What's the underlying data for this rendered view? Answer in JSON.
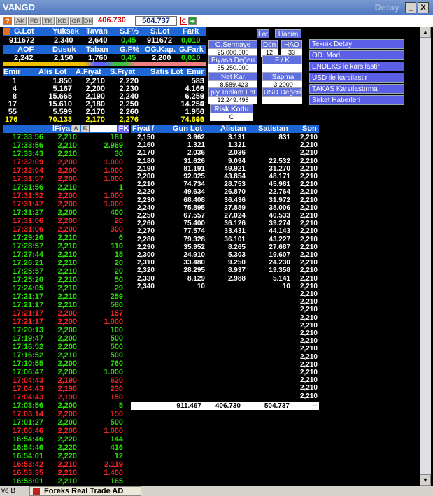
{
  "window": {
    "title": "VANGD",
    "detail": "Detay",
    "min": "_",
    "max": "□",
    "close": "X"
  },
  "toolbar": {
    "tabs": [
      "?",
      "AK",
      "FD",
      "TK",
      "KD",
      "GR",
      "DK"
    ],
    "value_red": "406.730",
    "value_blue": "504.737",
    "c_label": "C",
    "arrow": "➔"
  },
  "summary": {
    "r1_headers": [
      "G.Lot",
      "Yuksek",
      "Tavan",
      "S.F%",
      "S.Lot",
      "Fark"
    ],
    "r1_values": [
      "911672",
      "2,340",
      "2,640",
      "0,45",
      "911672",
      "0,010"
    ],
    "r2_headers": [
      "AOF",
      "Dusuk",
      "Taban",
      "G.F%",
      "OG.Kap.",
      "G.Fark"
    ],
    "r2_values": [
      "2,242",
      "2,150",
      "1,760",
      "0,45",
      "2,200",
      "0,010"
    ]
  },
  "depth": {
    "headers": [
      "Emir",
      "Alis Lot",
      "A.Fiyat",
      "S.Fiyat",
      "Satis Lot",
      "Emir"
    ],
    "rows": [
      [
        "1",
        "1.850",
        "2,210",
        "2,220",
        "585",
        "3"
      ],
      [
        "4",
        "5.167",
        "2,200",
        "2,230",
        "4.169",
        "6"
      ],
      [
        "8",
        "15.665",
        "2,190",
        "2,240",
        "6.259",
        "8"
      ],
      [
        "17",
        "15.610",
        "2,180",
        "2,250",
        "14.254",
        "9"
      ],
      [
        "55",
        "5.599",
        "2,170",
        "2,260",
        "1.950",
        "6"
      ]
    ],
    "totals": [
      "176",
      "70.133",
      "2,170",
      "2,276",
      "74.643",
      "90"
    ]
  },
  "stats": {
    "o_sermaye_label": "O.Sermaye",
    "o_sermaye": "25.000.000",
    "don_label": "Dön",
    "don": "12",
    "hao_label": "HAO",
    "hao": "33",
    "lot_label": "Lot",
    "hacim_label": "Hacim",
    "piyasa_label": "Piyasa Değeri",
    "piyasa": "55.250.000",
    "fk_label": "F / K",
    "fk": "",
    "net_kar_label": "Net Kar",
    "net_kar": "-8.589.423",
    "sapma_label": "'Sapma",
    "sapma": "-3.2000",
    "ply_label": "ply.Toplam Lot",
    "ply": "12.249.498",
    "usd_label": "USD Değeri",
    "usd": "",
    "risk_label": "Risk Kodu",
    "risk": "C"
  },
  "menu": [
    "Teknik Detay",
    "OD. Mod.",
    "ENDEKS le karsilastir",
    "USD ile karsilastir",
    "TAKAS Karsılastırma",
    "Sirket Haberleri"
  ],
  "trades": {
    "headers": {
      "fiyat": "lFiyat",
      "a": "A",
      "k": "K",
      "fk": "FK"
    },
    "rows": [
      [
        "17:33:56",
        "2,210",
        "181",
        "g"
      ],
      [
        "17:33:56",
        "2,210",
        "2.969",
        "g"
      ],
      [
        "17:33:43",
        "2,210",
        "30",
        "g"
      ],
      [
        "17:32:09",
        "2,200",
        "1.000",
        "r"
      ],
      [
        "17:32:04",
        "2,200",
        "1.000",
        "r"
      ],
      [
        "17:31:57",
        "2,200",
        "1.000",
        "r"
      ],
      [
        "17:31:56",
        "2,210",
        "1",
        "g"
      ],
      [
        "17:31:52",
        "2,200",
        "1.000",
        "r"
      ],
      [
        "17:31:47",
        "2,200",
        "1.000",
        "r"
      ],
      [
        "17:31:27",
        "2,200",
        "400",
        "g"
      ],
      [
        "17:31:06",
        "2,200",
        "20",
        "r"
      ],
      [
        "17:31:06",
        "2,200",
        "300",
        "r"
      ],
      [
        "17:29:26",
        "2,210",
        "6",
        "g"
      ],
      [
        "17:28:57",
        "2,210",
        "110",
        "g"
      ],
      [
        "17:27:44",
        "2,210",
        "15",
        "g"
      ],
      [
        "17:26:21",
        "2,210",
        "20",
        "g"
      ],
      [
        "17:25:57",
        "2,210",
        "20",
        "g"
      ],
      [
        "17:25:20",
        "2,210",
        "50",
        "g"
      ],
      [
        "17:24:05",
        "2,210",
        "29",
        "g"
      ],
      [
        "17:21:17",
        "2,210",
        "259",
        "g"
      ],
      [
        "17:21:17",
        "2,210",
        "580",
        "g"
      ],
      [
        "17:21:17",
        "2,200",
        "157",
        "r"
      ],
      [
        "17:21:17",
        "2,200",
        "1.000",
        "r"
      ],
      [
        "17:20:13",
        "2,200",
        "100",
        "g"
      ],
      [
        "17:19:47",
        "2,200",
        "500",
        "g"
      ],
      [
        "17:16:52",
        "2,200",
        "500",
        "g"
      ],
      [
        "17:16:52",
        "2,210",
        "500",
        "g"
      ],
      [
        "17:10:55",
        "2,200",
        "760",
        "g"
      ],
      [
        "17:06:47",
        "2,200",
        "1.000",
        "g"
      ],
      [
        "17:04:43",
        "2,190",
        "620",
        "r"
      ],
      [
        "17:04:43",
        "2,190",
        "230",
        "r"
      ],
      [
        "17:04:43",
        "2,190",
        "150",
        "r"
      ],
      [
        "17:03:56",
        "2,200",
        "5",
        "g"
      ],
      [
        "17:03:14",
        "2,200",
        "150",
        "r"
      ],
      [
        "17:01:27",
        "2,200",
        "500",
        "g"
      ],
      [
        "17:00:46",
        "2,200",
        "1.000",
        "r"
      ],
      [
        "16:54:46",
        "2,220",
        "144",
        "g"
      ],
      [
        "16:54:46",
        "2,220",
        "416",
        "g"
      ],
      [
        "16:54:01",
        "2,220",
        "12",
        "g"
      ],
      [
        "16:53:42",
        "2,210",
        "2.119",
        "r"
      ],
      [
        "16:53:35",
        "2,210",
        "1.400",
        "r"
      ],
      [
        "16:53:01",
        "2,210",
        "165",
        "g"
      ]
    ]
  },
  "dist": {
    "headers": [
      "Fiyat",
      "Gun Lot",
      "Alistan",
      "Satistan",
      "Son"
    ],
    "sort_mark": "/",
    "rows": [
      [
        "2,150",
        "3.962",
        "3.131",
        "831",
        "2,210"
      ],
      [
        "2,160",
        "1.321",
        "1.321",
        "",
        "2,210"
      ],
      [
        "2,170",
        "2.036",
        "2.036",
        "",
        "2,210"
      ],
      [
        "2,180",
        "31.626",
        "9.094",
        "22.532",
        "2,210"
      ],
      [
        "2,190",
        "81.191",
        "49.921",
        "31.270",
        "2,210"
      ],
      [
        "2,200",
        "92.025",
        "43.854",
        "48.171",
        "2,210"
      ],
      [
        "2,210",
        "74.734",
        "28.753",
        "45.981",
        "2,210"
      ],
      [
        "2,220",
        "49.634",
        "26.870",
        "22.764",
        "2,210"
      ],
      [
        "2,230",
        "68.408",
        "36.436",
        "31.972",
        "2,210"
      ],
      [
        "2,240",
        "75.895",
        "37.889",
        "38.006",
        "2,210"
      ],
      [
        "2,250",
        "67.557",
        "27.024",
        "40.533",
        "2,210"
      ],
      [
        "2,260",
        "75.400",
        "36.126",
        "39.274",
        "2,210"
      ],
      [
        "2,270",
        "77.574",
        "33.431",
        "44.143",
        "2,210"
      ],
      [
        "2,280",
        "79.328",
        "36.101",
        "43.227",
        "2,210"
      ],
      [
        "2,290",
        "35.952",
        "8.265",
        "27.687",
        "2,210"
      ],
      [
        "2,300",
        "24.910",
        "5.303",
        "19.607",
        "2,210"
      ],
      [
        "2,310",
        "33.480",
        "9.250",
        "24.230",
        "2,210"
      ],
      [
        "2,320",
        "28.295",
        "8.937",
        "19.358",
        "2,210"
      ],
      [
        "2,330",
        "8.129",
        "2.988",
        "5.141",
        "2,210"
      ],
      [
        "2,340",
        "10",
        "",
        "10",
        "2,210"
      ],
      [
        "",
        "",
        "",
        "",
        "2,210"
      ],
      [
        "",
        "",
        "",
        "",
        "2,210"
      ],
      [
        "",
        "",
        "",
        "",
        "2,210"
      ],
      [
        "",
        "",
        "",
        "",
        "2,210"
      ],
      [
        "",
        "",
        "",
        "",
        "2,210"
      ],
      [
        "",
        "",
        "",
        "",
        "2,210"
      ],
      [
        "",
        "",
        "",
        "",
        "2,210"
      ],
      [
        "",
        "",
        "",
        "",
        "2,210"
      ],
      [
        "",
        "",
        "",
        "",
        "2,210"
      ],
      [
        "",
        "",
        "",
        "",
        "2,210"
      ],
      [
        "",
        "",
        "",
        "",
        "2,210"
      ],
      [
        "",
        "",
        "",
        "",
        "2,210"
      ],
      [
        "",
        "",
        "",
        "",
        "2,210"
      ],
      [
        "",
        "",
        "",
        "",
        "2,210"
      ]
    ],
    "totals": [
      "",
      "911.467",
      "406.730",
      "504.737",
      "--"
    ]
  },
  "taskbar": {
    "left": "ve B",
    "app": "Foreks Real Trade AD"
  }
}
